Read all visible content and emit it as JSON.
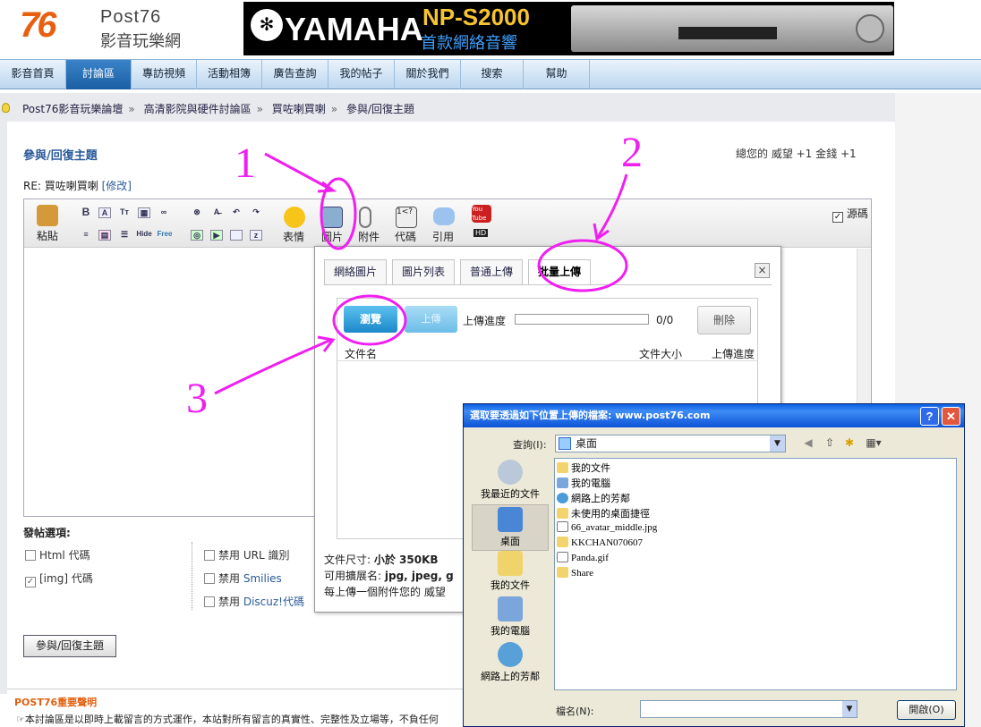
{
  "header": {
    "logo_number": "76",
    "logo_brand": "Post76",
    "logo_sub": "影音玩樂網",
    "banner": {
      "brand": "YAMAHA",
      "model": "NP-S2000",
      "tagline": "首款網絡音響"
    }
  },
  "nav": {
    "items": [
      {
        "label": "影音首頁",
        "active": false
      },
      {
        "label": "討論區",
        "active": true
      },
      {
        "label": "專訪視頻",
        "active": false
      },
      {
        "label": "活動相簿",
        "active": false
      },
      {
        "label": "廣告查詢",
        "active": false
      },
      {
        "label": "我的帖子",
        "active": false
      },
      {
        "label": "關於我們",
        "active": false
      },
      {
        "label": "搜索",
        "active": false
      },
      {
        "label": "幫助",
        "active": false
      }
    ]
  },
  "breadcrumb": [
    "Post76影音玩樂論壇",
    "高清影院與硬件討論區",
    "買咗喇買喇",
    "參與/回復主題"
  ],
  "post": {
    "title": "參與/回復主題",
    "credits": "總您的 威望 +1  金錢 +1",
    "subject_prefix": "RE: 買咗喇買喇",
    "subject_edit": "[修改]"
  },
  "toolbar": {
    "paste": "粘貼",
    "emoticon": "表情",
    "image": "圖片",
    "attach": "附件",
    "code": "代碼",
    "quote": "引用",
    "source": "源碼",
    "hd": "HD",
    "youtube": "You Tube",
    "hide": "Hide",
    "free": "Free"
  },
  "options": {
    "title": "發帖選項:",
    "html": "Html 代碼",
    "img": "[img] 代碼",
    "url_prefix": "禁用",
    "url": "URL 識別",
    "smilies_prefix": "禁用",
    "smilies": "Smilies",
    "discuz_prefix": "禁用",
    "discuz": "Discuz!代碼"
  },
  "submit_label": "參與/回復主題",
  "notice": {
    "title": "POST76重要聲明",
    "text": "☞本討論區是以即時上載留言的方式運作，本站對所有留言的真實性、完整性及立場等，不負任何"
  },
  "upload": {
    "tabs": [
      {
        "label": "網絡圖片",
        "active": false
      },
      {
        "label": "圖片列表",
        "active": false
      },
      {
        "label": "普通上傳",
        "active": false
      },
      {
        "label": "批量上傳",
        "active": true
      }
    ],
    "close": "×",
    "browse": "瀏覽",
    "upload": "上傳",
    "progress_label": "上傳進度",
    "progress_value": "0/0",
    "delete": "刪除",
    "columns": [
      "文件名",
      "文件大小",
      "上傳進度"
    ],
    "size_label": "文件尺寸:",
    "size_value": "小於 350KB",
    "ext_label": "可用擴展名:",
    "ext_value": "jpg, jpeg, g",
    "per_upload": "每上傳一個附件您的 威望"
  },
  "file_dialog": {
    "title": "選取要透過如下位置上傳的檔案: www.post76.com",
    "help": "?",
    "close": "✕",
    "look_in_label": "查詢(I):",
    "look_in_value": "桌面",
    "places": [
      {
        "label": "我最近的文件",
        "icon": "recent-documents-icon",
        "selected": false
      },
      {
        "label": "桌面",
        "icon": "desktop-icon",
        "selected": true
      },
      {
        "label": "我的文件",
        "icon": "my-documents-icon",
        "selected": false
      },
      {
        "label": "我的電腦",
        "icon": "my-computer-icon",
        "selected": false
      },
      {
        "label": "網路上的芳鄰",
        "icon": "network-places-icon",
        "selected": false
      }
    ],
    "files": [
      {
        "name": "我的文件",
        "icon": "folder-icon"
      },
      {
        "name": "我的電腦",
        "icon": "computer-icon"
      },
      {
        "name": "網路上的芳鄰",
        "icon": "network-icon"
      },
      {
        "name": "未使用的桌面捷徑",
        "icon": "folder-icon"
      },
      {
        "name": "66_avatar_middle.jpg",
        "icon": "image-file-icon"
      },
      {
        "name": "KKCHAN070607",
        "icon": "folder-icon"
      },
      {
        "name": "Panda.gif",
        "icon": "image-file-icon"
      },
      {
        "name": "Share",
        "icon": "shared-folder-icon"
      }
    ],
    "filename_label": "檔名(N):",
    "open_button": "開啟(O)"
  },
  "annotations": [
    "1",
    "2",
    "3"
  ],
  "colors": {
    "annotation": "#f01ff0",
    "nav_active": "#1b5fa3",
    "link": "#2a5a9a"
  }
}
